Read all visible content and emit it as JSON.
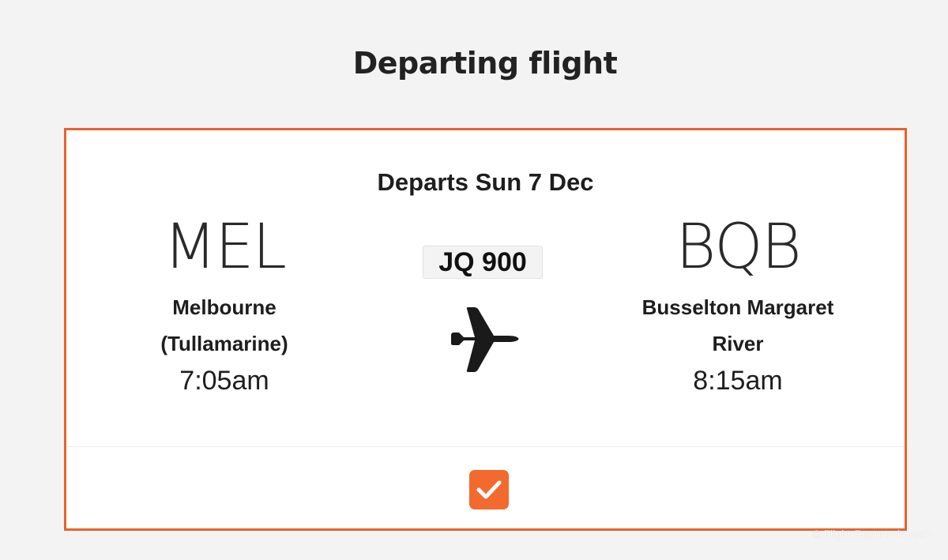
{
  "page": {
    "title": "Departing flight"
  },
  "flight": {
    "departs_label": "Departs Sun 7 Dec",
    "flight_number": "JQ 900",
    "origin": {
      "code": "MEL",
      "name_line1": "Melbourne",
      "name_line2": "(Tullamarine)",
      "time": "7:05am"
    },
    "destination": {
      "code": "BQB",
      "name_line1": "Busselton Margaret",
      "name_line2": "River",
      "time": "8:15am"
    },
    "selected": true
  },
  "icons": {
    "plane": "airplane-icon",
    "check": "checkmark-icon"
  },
  "colors": {
    "accent": "#f26a2e",
    "border": "#e8622a",
    "background": "#f3f3f3",
    "card": "#ffffff"
  },
  "watermark": "© Flight-Report - koresh"
}
